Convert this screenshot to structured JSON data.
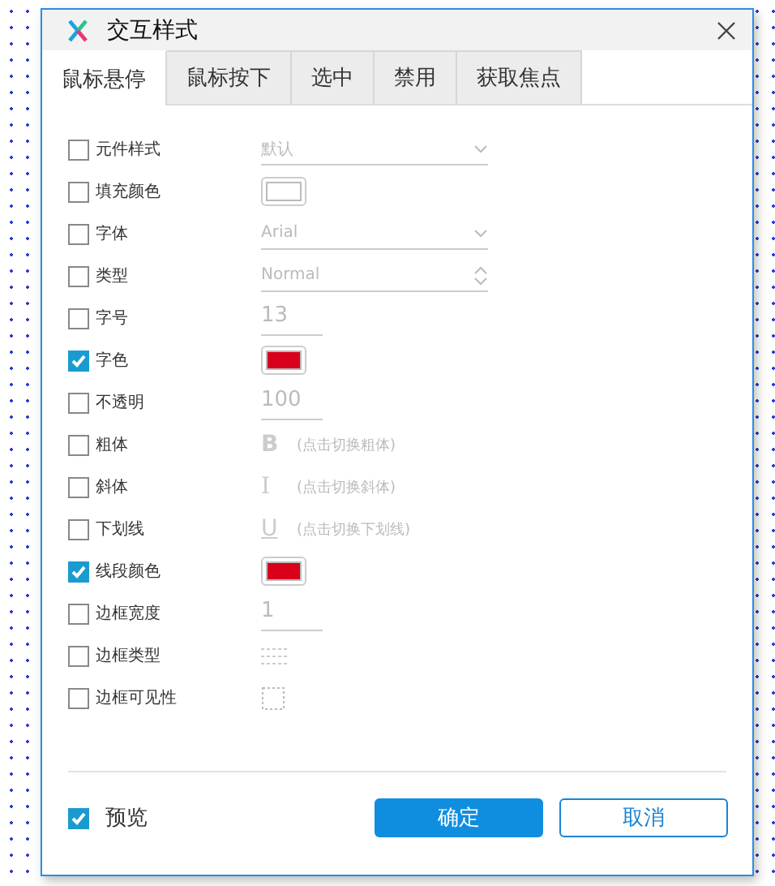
{
  "window": {
    "title": "交互样式"
  },
  "tabs": [
    {
      "label": "鼠标悬停",
      "selected": true
    },
    {
      "label": "鼠标按下",
      "selected": false
    },
    {
      "label": "选中",
      "selected": false
    },
    {
      "label": "禁用",
      "selected": false
    },
    {
      "label": "获取焦点",
      "selected": false
    }
  ],
  "properties": [
    {
      "label": "元件样式",
      "checked": false,
      "kind": "select",
      "value": "默认"
    },
    {
      "label": "填充颜色",
      "checked": false,
      "kind": "color",
      "color": "#ffffff"
    },
    {
      "label": "字体",
      "checked": false,
      "kind": "select",
      "value": "Arial"
    },
    {
      "label": "类型",
      "checked": false,
      "kind": "spinner",
      "value": "Normal"
    },
    {
      "label": "字号",
      "checked": false,
      "kind": "number",
      "value": "13"
    },
    {
      "label": "字色",
      "checked": true,
      "kind": "color",
      "color": "#d9001b"
    },
    {
      "label": "不透明",
      "checked": false,
      "kind": "number",
      "value": "100"
    },
    {
      "label": "粗体",
      "checked": false,
      "kind": "bold",
      "glyph": "B",
      "hint": "(点击切换粗体)"
    },
    {
      "label": "斜体",
      "checked": false,
      "kind": "italic",
      "glyph": "I",
      "hint": "(点击切换斜体)"
    },
    {
      "label": "下划线",
      "checked": false,
      "kind": "underline",
      "glyph": "U",
      "hint": "(点击切换下划线)"
    },
    {
      "label": "线段颜色",
      "checked": true,
      "kind": "color",
      "color": "#d9001b"
    },
    {
      "label": "边框宽度",
      "checked": false,
      "kind": "number",
      "value": "1"
    },
    {
      "label": "边框类型",
      "checked": false,
      "kind": "linestyle"
    },
    {
      "label": "边框可见性",
      "checked": false,
      "kind": "visibility"
    }
  ],
  "preview": {
    "label": "预览",
    "checked": true
  },
  "buttons": [
    {
      "label": "确定",
      "kind": "primary"
    },
    {
      "label": "取消",
      "kind": "secondary"
    }
  ]
}
